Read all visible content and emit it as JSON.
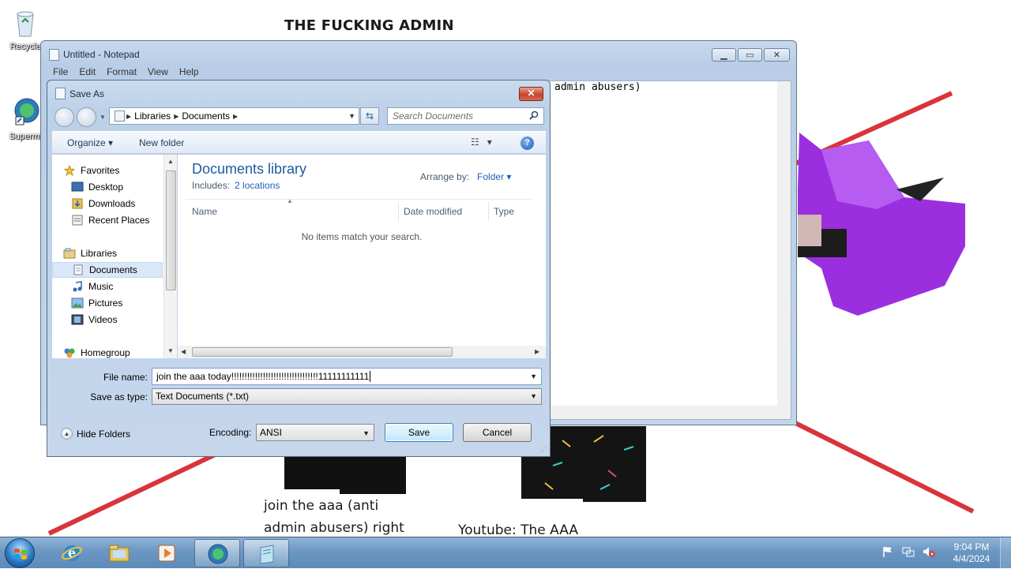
{
  "desktop": {
    "meme_title": "THE FUCKING ADMIN",
    "meme_caption": "join the aaa (anti admin abusers) right",
    "meme_youtube": "Youtube: The AAA",
    "icons": [
      {
        "label": "Recycle"
      },
      {
        "label": "Supermi"
      }
    ],
    "stripe_color": "#d9343a",
    "blob_color": "#9b2fe0"
  },
  "notepad": {
    "title": "Untitled - Notepad",
    "menu": [
      "File",
      "Edit",
      "Format",
      "View",
      "Help"
    ],
    "text": "admin abusers)"
  },
  "saveas": {
    "title": "Save As",
    "close_glyph": "✕",
    "breadcrumb": [
      "Libraries",
      "Documents"
    ],
    "search_placeholder": "Search Documents",
    "organize_label": "Organize",
    "new_folder_label": "New folder",
    "nav": {
      "favorites": "Favorites",
      "desktop": "Desktop",
      "downloads": "Downloads",
      "recent": "Recent Places",
      "libraries": "Libraries",
      "documents": "Documents",
      "music": "Music",
      "pictures": "Pictures",
      "videos": "Videos",
      "homegroup": "Homegroup"
    },
    "library_title": "Documents library",
    "includes_label": "Includes:",
    "includes_link": "2 locations",
    "arrange_label": "Arrange by:",
    "arrange_value": "Folder",
    "columns": {
      "name": "Name",
      "date": "Date modified",
      "type": "Type"
    },
    "empty_message": "No items match your search.",
    "file_name_label": "File name:",
    "file_name_value": "join the aaa today!!!!!!!!!!!!!!!!!!!!!!!!!!!!!!!!!11111111111",
    "save_type_label": "Save as type:",
    "save_type_value": "Text Documents (*.txt)",
    "hide_folders_label": "Hide Folders",
    "encoding_label": "Encoding:",
    "encoding_value": "ANSI",
    "save_label": "Save",
    "cancel_label": "Cancel"
  },
  "taskbar": {
    "time": "9:04 PM",
    "date": "4/4/2024"
  }
}
